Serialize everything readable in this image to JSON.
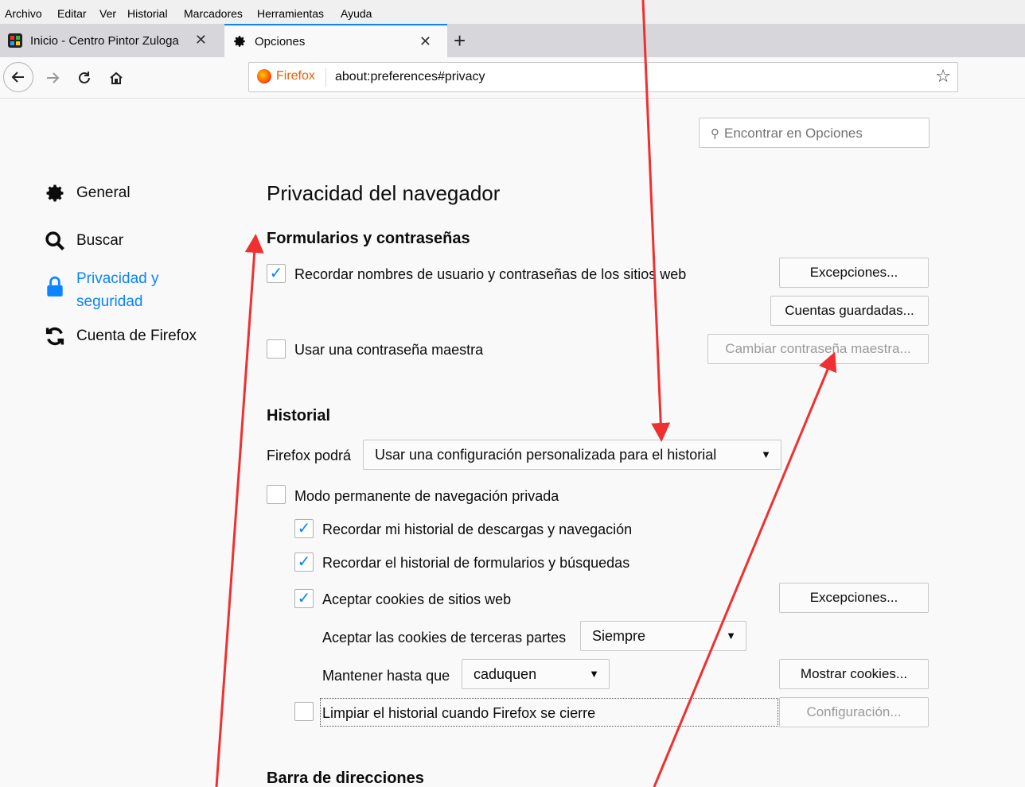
{
  "menubar": {
    "items": [
      "Archivo",
      "Editar",
      "Ver",
      "Historial",
      "Marcadores",
      "Herramientas",
      "Ayuda"
    ]
  },
  "tabs": [
    {
      "title": "Inicio - Centro Pintor Zuloga",
      "active": false
    },
    {
      "title": "Opciones",
      "active": true
    }
  ],
  "nav": {
    "identity_label": "Firefox",
    "url": "about:preferences#privacy"
  },
  "search": {
    "placeholder": "Encontrar en Opciones"
  },
  "categories": [
    {
      "label": "General",
      "icon": "gear-icon"
    },
    {
      "label": "Buscar",
      "icon": "search-icon"
    },
    {
      "label": "Privacidad y",
      "label2": "seguridad",
      "icon": "lock-icon",
      "active": true
    },
    {
      "label": "Cuenta de Firefox",
      "icon": "sync-icon"
    }
  ],
  "page_title": "Privacidad del navegador",
  "forms": {
    "heading": "Formularios y contraseñas",
    "remember_logins": {
      "label": "Recordar nombres de usuario y contraseñas de los sitios web",
      "checked": true
    },
    "exceptions_btn": "Excepciones...",
    "saved_logins_btn": "Cuentas guardadas...",
    "master_password": {
      "label": "Usar una contraseña maestra",
      "checked": false
    },
    "change_master_btn": "Cambiar contraseña maestra..."
  },
  "history": {
    "heading": "Historial",
    "mode_label": "Firefox podrá",
    "mode_value": "Usar una configuración personalizada para el historial",
    "private_mode": {
      "label": "Modo permanente de navegación privada",
      "checked": false
    },
    "remember_downloads": {
      "label": "Recordar mi historial de descargas y navegación",
      "checked": true
    },
    "remember_forms": {
      "label": "Recordar el historial de formularios y búsquedas",
      "checked": true
    },
    "accept_cookies": {
      "label": "Aceptar cookies de sitios web",
      "checked": true
    },
    "cookie_exceptions_btn": "Excepciones...",
    "third_party_label": "Aceptar las cookies de terceras partes",
    "third_party_value": "Siempre",
    "keep_until_label": "Mantener hasta que",
    "keep_until_value": "caduquen",
    "show_cookies_btn": "Mostrar cookies...",
    "clear_on_close": {
      "label": "Limpiar el historial cuando Firefox se cierre",
      "checked": false
    },
    "settings_btn": "Configuración..."
  },
  "address_bar": {
    "heading": "Barra de direcciones"
  },
  "colors": {
    "accent": "#0a84ff",
    "annotation": "#f03030"
  }
}
